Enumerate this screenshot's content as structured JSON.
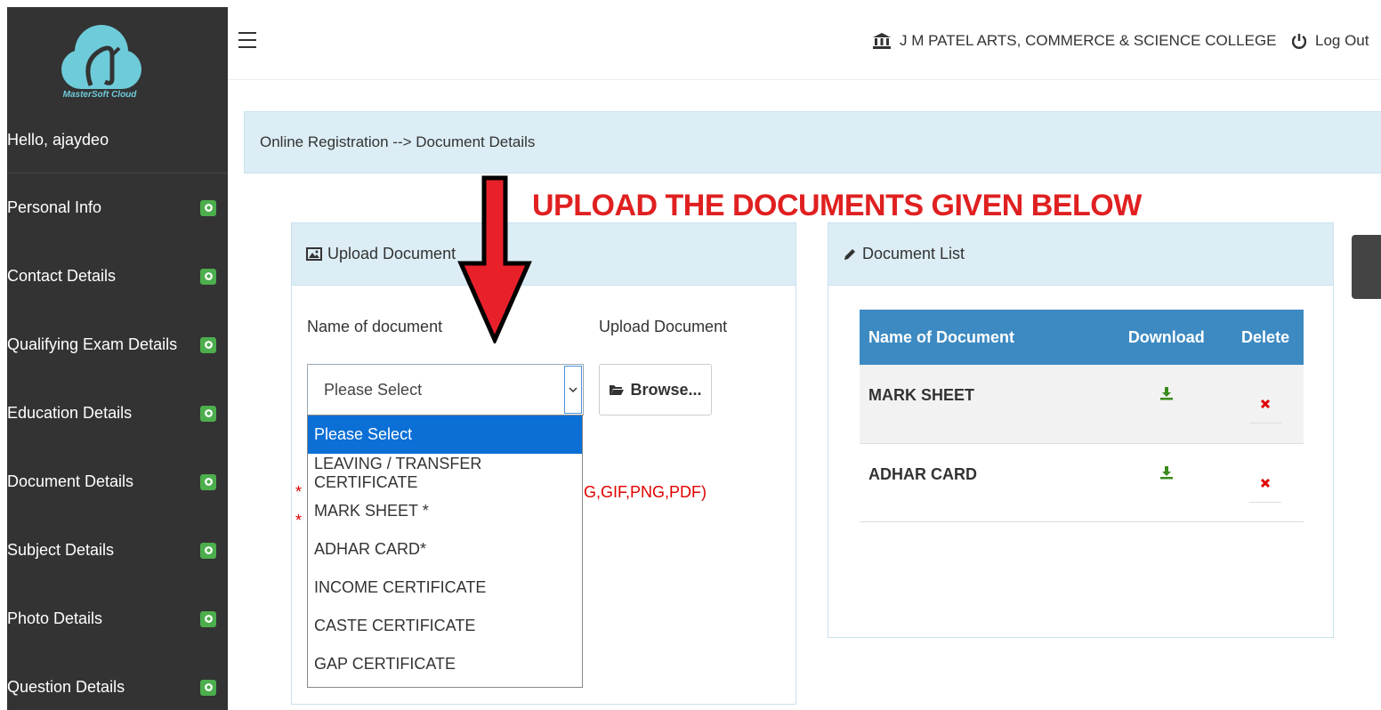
{
  "sidebar": {
    "logo_text": "MasterSoft Cloud",
    "greeting": "Hello, ajaydeo",
    "items": [
      {
        "label": "Personal Info"
      },
      {
        "label": "Contact Details"
      },
      {
        "label": "Qualifying Exam Details"
      },
      {
        "label": "Education Details"
      },
      {
        "label": "Document Details"
      },
      {
        "label": "Subject Details"
      },
      {
        "label": "Photo Details"
      },
      {
        "label": "Question Details"
      }
    ]
  },
  "header": {
    "college": "J M PATEL ARTS, COMMERCE & SCIENCE COLLEGE",
    "logout": "Log Out"
  },
  "breadcrumb": "Online Registration --> Document Details",
  "annotation": "UPLOAD THE DOCUMENTS GIVEN BELOW",
  "upload_panel": {
    "title": "Upload Document",
    "name_label": "Name of document",
    "upload_label": "Upload Document",
    "select_value": "Please Select",
    "browse_label": "Browse...",
    "note1_prefix": "* (",
    "note1_suffix": "G,GIF,PNG,PDF)",
    "note2_prefix": "* ("
  },
  "dropdown_options": [
    "Please Select",
    "LEAVING / TRANSFER CERTIFICATE",
    "MARK SHEET *",
    "ADHAR CARD*",
    "INCOME CERTIFICATE",
    "CASTE CERTIFICATE",
    "GAP CERTIFICATE"
  ],
  "doc_list": {
    "title": "Document List",
    "columns": [
      "Name of Document",
      "Download",
      "Delete"
    ],
    "rows": [
      {
        "name": "MARK SHEET"
      },
      {
        "name": "ADHAR CARD"
      }
    ]
  },
  "colors": {
    "sidebar_bg": "#333333",
    "panel_head_bg": "#dcedf5",
    "table_head_bg": "#3d8ac2",
    "badge_green": "#4cae4c",
    "annotation_red": "#e02020",
    "selected_option": "#0b6fd6"
  }
}
